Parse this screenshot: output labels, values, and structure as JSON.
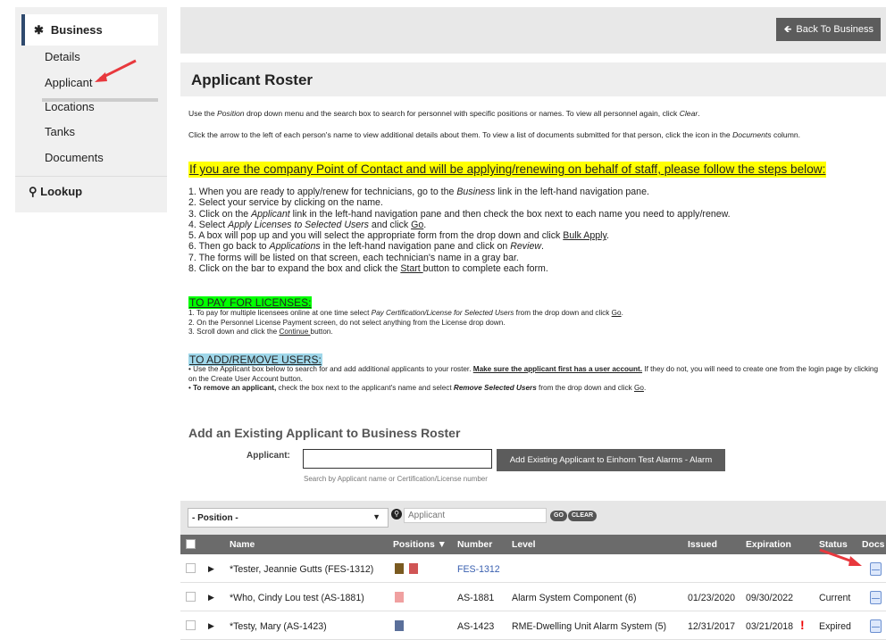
{
  "sidebar": {
    "active_label": "Business",
    "items": [
      {
        "label": "Details"
      },
      {
        "label": "Applicant"
      },
      {
        "label": "Locations"
      },
      {
        "label": "Tanks"
      },
      {
        "label": "Documents"
      }
    ],
    "lookup_label": "Lookup"
  },
  "topbar": {
    "back_label": "Back To Business"
  },
  "page": {
    "title": "Applicant Roster",
    "intro1_a": "Use the ",
    "intro1_b": "Position",
    "intro1_c": " drop down menu and the search box to search for personnel with specific positions or names. To view all personnel again, click ",
    "intro1_d": "Clear",
    "intro1_e": ".",
    "intro2_a": "Click the arrow to the left of each person's name to view additional details about them. To view a list of documents submitted for that person, click the icon in the ",
    "intro2_b": "Documents",
    "intro2_c": " column.",
    "poc_heading": "If you are the company Point of Contact and will be applying/renewing on behalf of staff, please follow the steps below:",
    "steps": [
      [
        "1. When you are ready to apply/renew for technicians, go to the ",
        "Business",
        " link in the left-hand navigation pane."
      ],
      [
        "2. Select your service by clicking on the name."
      ],
      [
        "3. Click on the ",
        "Applicant",
        " link in the left-hand navigation pane and then check the box next to each name you need to apply/renew."
      ],
      [
        "4. Select ",
        "Apply Licenses to Selected Users",
        " and click ",
        "Go",
        "."
      ],
      [
        "5. A box will pop up and you will select the appropriate form from the drop down and click ",
        "Bulk Apply",
        "."
      ],
      [
        "6. Then go back to ",
        "Applications",
        " in the left-hand navigation pane and click on ",
        "Review",
        "."
      ],
      [
        "7. The forms will be listed on that screen, each technician's name in a gray bar."
      ],
      [
        "8. Click on the bar to expand the box and click the ",
        "Start ",
        "button to complete each form."
      ]
    ],
    "pay_heading": "TO PAY FOR LICENSES:",
    "pay_steps": [
      [
        "1. To pay for multiple licensees online at one time select ",
        "Pay Certification/License for Selected Users",
        " from the drop down and click ",
        "Go",
        "."
      ],
      [
        "2. On the Personnel License Payment screen, do not select anything from the License drop down."
      ],
      [
        "3. Scroll down and click the ",
        "Continue ",
        "button."
      ]
    ],
    "add_heading": "TO ADD/REMOVE USERS:",
    "add_1a": "Use the Applicant box below to search for and add additional applicants to your roster. ",
    "add_1b": "Make sure the applicant first has a user account.",
    "add_1c": " If they do not, you will need to create one from the login page by clicking on the Create User Account button.",
    "add_2a": "To remove an applicant,",
    "add_2b": " check the box next to the applicant's name and select ",
    "add_2c": "Remove Selected Users",
    "add_2d": " from the drop down and click ",
    "add_2e": "Go",
    "add_2f": "."
  },
  "add_section": {
    "title": "Add an Existing Applicant to Business Roster",
    "applicant_label": "Applicant:",
    "button_label": "Add Existing Applicant to Einhorn Test Alarms - Alarm",
    "hint": "Search by Applicant name or Certification/License number"
  },
  "filter": {
    "position_value": "- Position -",
    "search_placeholder": "Applicant",
    "go_label": "GO",
    "clear_label": "CLEAR"
  },
  "table": {
    "headers": {
      "name": "Name",
      "positions": "Positions ▼",
      "number": "Number",
      "level": "Level",
      "issued": "Issued",
      "expiration": "Expiration",
      "status": "Status",
      "docs": "Docs"
    },
    "rows": [
      {
        "name": "*Tester, Jeannie Gutts (FES-1312)",
        "number": "FES-1312",
        "level": "",
        "issued": "",
        "expiration": "",
        "status": ""
      },
      {
        "name": "*Who, Cindy Lou test (AS-1881)",
        "number": "AS-1881",
        "level": "Alarm System Component (6)",
        "issued": "01/23/2020",
        "expiration": "09/30/2022",
        "status": "Current"
      },
      {
        "name": "*Testy, Mary (AS-1423)",
        "number": "AS-1423",
        "level": "RME-Dwelling Unit Alarm System (5)",
        "issued": "12/31/2017",
        "expiration": "03/21/2018",
        "status": "Expired"
      }
    ]
  },
  "colors": {
    "highlight_yellow": "#ffff00",
    "highlight_green": "#00ff00",
    "highlight_blue": "#9fd7ea",
    "annotation_red": "#e8383d",
    "table_header": "#6b6b6b"
  }
}
